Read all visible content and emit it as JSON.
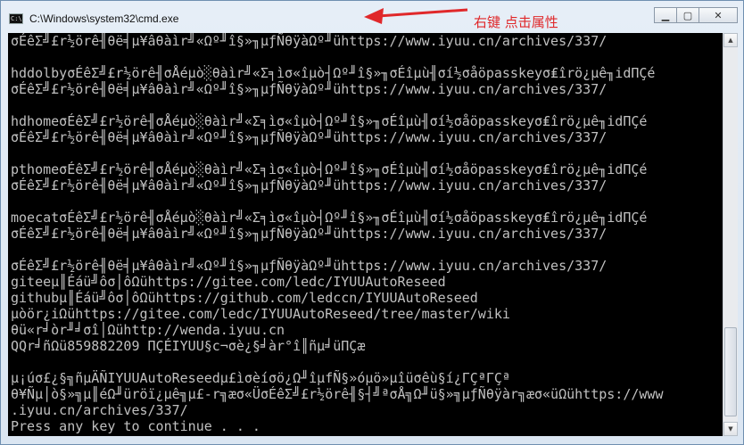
{
  "window": {
    "title": "C:\\Windows\\system32\\cmd.exe",
    "annotation": "右键  点击属性",
    "controls": {
      "minimize": "▁",
      "maximize": "▢",
      "close": "✕"
    }
  },
  "console": {
    "lines": [
      "σÉêΣ╝£r½örê╢θë╡µ¥âθàìr╝«Ωº╜î§»╖µƒÑθÿàΩº╜ühttps://www.iyuu.cn/archives/337/",
      "",
      "hddolbyσÉêΣ╝£r½örê╢σÅéµò░θàìr╝«Σ╕ìσ«îµò┤Ωº╜î§»╖σÉîµù╢σí½σåöpasskeyσ₤îrö¿µê╖idΠÇé",
      "σÉêΣ╝£r½örê╢θë╡µ¥âθàìr╝«Ωº╜î§»╖µƒÑθÿàΩº╜ühttps://www.iyuu.cn/archives/337/",
      "",
      "hdhomeσÉêΣ╝£r½örê╢σÅéµò░θàìr╝«Σ╕ìσ«îµò┤Ωº╜î§»╖σÉîµù╢σí½σåöpasskeyσ₤îrö¿µê╖idΠÇé",
      "σÉêΣ╝£r½örê╢θë╡µ¥âθàìr╝«Ωº╜î§»╖µƒÑθÿàΩº╜ühttps://www.iyuu.cn/archives/337/",
      "",
      "pthomeσÉêΣ╝£r½örê╢σÅéµò░θàìr╝«Σ╕ìσ«îµò┤Ωº╜î§»╖σÉîµù╢σí½σåöpasskeyσ₤îrö¿µê╖idΠÇé",
      "σÉêΣ╝£r½örê╢θë╡µ¥âθàìr╝«Ωº╜î§»╖µƒÑθÿàΩº╜ühttps://www.iyuu.cn/archives/337/",
      "",
      "moecatσÉêΣ╝£r½örê╢σÅéµò░θàìr╝«Σ╕ìσ«îµò┤Ωº╜î§»╖σÉîµù╢σí½σåöpasskeyσ₤îrö¿µê╖idΠÇé",
      "σÉêΣ╝£r½örê╢θë╡µ¥âθàìr╝«Ωº╜î§»╖µƒÑθÿàΩº╜ühttps://www.iyuu.cn/archives/337/",
      "",
      "σÉêΣ╝£r½örê╢θë╡µ¥âθàìr╝«Ωº╜î§»╖µƒÑθÿàΩº╜ühttps://www.iyuu.cn/archives/337/",
      "giteeµ║Éáü╝ôσ│ôΩühttps://gitee.com/ledc/IYUUAutoReseed",
      "githubµ║Éáü╝ôσ│ôΩühttps://github.com/ledccn/IYUUAutoReseed",
      "µòör¿iΩühttps://gitee.com/ledc/IYUUAutoReseed/tree/master/wiki",
      "θü«r╛òr╜╛σî│Ωühttp://wenda.iyuu.cn",
      "QQr╛ñΩü859882209 ΠÇÉIYUU§c¬σè¿§╛àr°î║ñµ╛üΠÇæ",
      "",
      "µ¡úσ£¿§╗ñµÄÑIYUUAutoReseedµ£ìσèíσö¿Ω╜îµfÑ§»óµö»µîüσêù§í¿ΓÇªΓÇª",
      "θ¥Ñµ│ò§»╗µ║éΩ╜üröï¿µê╗µ£-r╗æσ«ÜσÉêΣ╝£r½örê╢§┤╝ªσÅ╗Ω╜ü§»╗µƒÑθÿàr╗æσ«üΩühttps://www",
      ".iyuu.cn/archives/337/",
      "Press any key to continue . . ."
    ]
  },
  "colors": {
    "console_bg": "#000000",
    "console_fg": "#c0c0c0",
    "annotation": "#e0282a"
  },
  "icons": [
    "cmd-app-icon",
    "annotation-arrow-icon",
    "minimize-icon",
    "maximize-icon",
    "close-icon",
    "scroll-up-icon",
    "scroll-down-icon"
  ]
}
